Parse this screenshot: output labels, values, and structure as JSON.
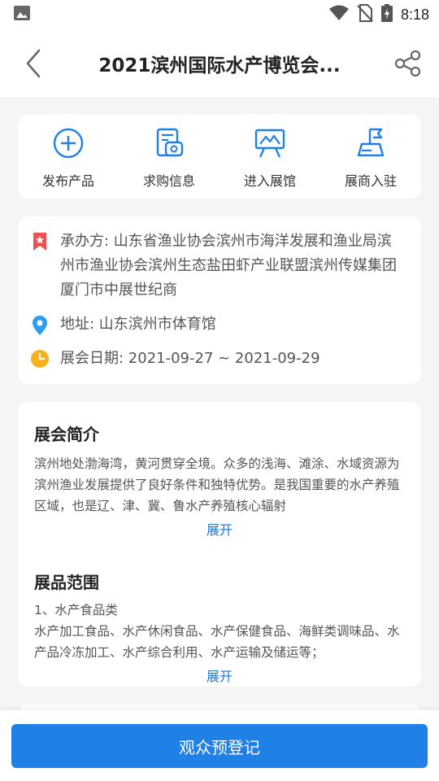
{
  "status_bar": {
    "time": "8:18"
  },
  "nav": {
    "title": "2021滨州国际水产博览会..."
  },
  "quick_actions": [
    {
      "label": "发布产品",
      "icon": "plus-circle-icon"
    },
    {
      "label": "求购信息",
      "icon": "purchase-doc-icon"
    },
    {
      "label": "进入展馆",
      "icon": "exhibition-hall-icon"
    },
    {
      "label": "展商入驻",
      "icon": "exhibitor-flag-icon"
    }
  ],
  "info": {
    "organizer": "承办方: 山东省渔业协会滨州市海洋发展和渔业局滨州市渔业协会滨州生态盐田虾产业联盟滨州传媒集团厦门市中展世纪商",
    "address": "地址: 山东滨州市体育馆",
    "date": "展会日期: 2021-09-27 ~ 2021-09-29"
  },
  "intro": {
    "title": "展会简介",
    "body": "滨州地处渤海湾，黄河贯穿全境。众多的浅海、滩涂、水域资源为滨州渔业发展提供了良好条件和独特优势。是我国重要的水产养殖区域，也是辽、津、冀、鲁水产养殖核心辐射",
    "expand": "展开"
  },
  "scope": {
    "title": "展品范围",
    "line1": "1、水产食品类",
    "body": "水产加工食品、水产休闲食品、水产保健食品、海鲜类调味品、水产品冷冻加工、水产综合利用、水产运输及储运等；",
    "expand": "展开"
  },
  "bottom": {
    "register_label": "观众预登记"
  },
  "colors": {
    "accent": "#1f80e6",
    "link": "#1a76d9",
    "bookmark": "#f0504f",
    "location": "#2f9cf3",
    "clock": "#f6b21a"
  }
}
